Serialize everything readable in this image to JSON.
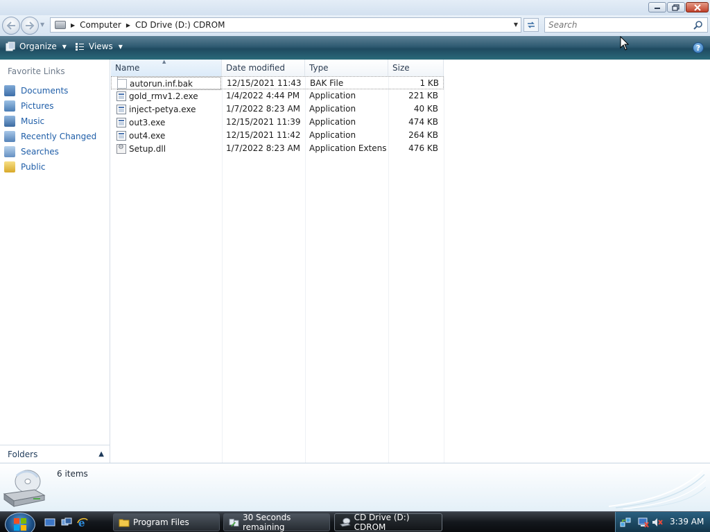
{
  "window": {
    "controls": [
      "minimize",
      "maximize",
      "close"
    ]
  },
  "nav": {
    "back_icon": "back-arrow-icon",
    "forward_icon": "forward-arrow-icon"
  },
  "address": {
    "crumbs": [
      "Computer",
      "CD Drive (D:) CDROM"
    ]
  },
  "search": {
    "placeholder": "Search"
  },
  "toolbar": {
    "organize_label": "Organize",
    "views_label": "Views"
  },
  "sidebar": {
    "favorite_links_title": "Favorite Links",
    "items": [
      {
        "label": "Documents",
        "icon": "documents-icon"
      },
      {
        "label": "Pictures",
        "icon": "pictures-icon"
      },
      {
        "label": "Music",
        "icon": "music-icon"
      },
      {
        "label": "Recently Changed",
        "icon": "recently-changed-icon"
      },
      {
        "label": "Searches",
        "icon": "searches-icon"
      },
      {
        "label": "Public",
        "icon": "public-folder-icon"
      }
    ],
    "folders_label": "Folders"
  },
  "columns": {
    "name": "Name",
    "date": "Date modified",
    "type": "Type",
    "size": "Size"
  },
  "files": [
    {
      "name": "autorun.inf.bak",
      "date": "12/15/2021 11:43 ...",
      "type": "BAK File",
      "size": "1 KB",
      "icon": "bak"
    },
    {
      "name": "gold_rmv1.2.exe",
      "date": "1/4/2022 4:44 PM",
      "type": "Application",
      "size": "221 KB",
      "icon": "exe"
    },
    {
      "name": "inject-petya.exe",
      "date": "1/7/2022 8:23 AM",
      "type": "Application",
      "size": "40 KB",
      "icon": "exe"
    },
    {
      "name": "out3.exe",
      "date": "12/15/2021 11:39 ...",
      "type": "Application",
      "size": "474 KB",
      "icon": "exe"
    },
    {
      "name": "out4.exe",
      "date": "12/15/2021 11:42 ...",
      "type": "Application",
      "size": "264 KB",
      "icon": "exe"
    },
    {
      "name": "Setup.dll",
      "date": "1/7/2022 8:23 AM",
      "type": "Application Extens...",
      "size": "476 KB",
      "icon": "dll"
    }
  ],
  "details": {
    "items_count": "6 items"
  },
  "taskbar": {
    "tasks": [
      {
        "label": "Program Files",
        "icon": "folder-icon"
      },
      {
        "label": "30 Seconds remaining",
        "icon": "copy-progress-icon"
      },
      {
        "label": "CD Drive (D:) CDROM",
        "icon": "cd-drive-icon"
      }
    ],
    "clock": "3:39 AM"
  }
}
